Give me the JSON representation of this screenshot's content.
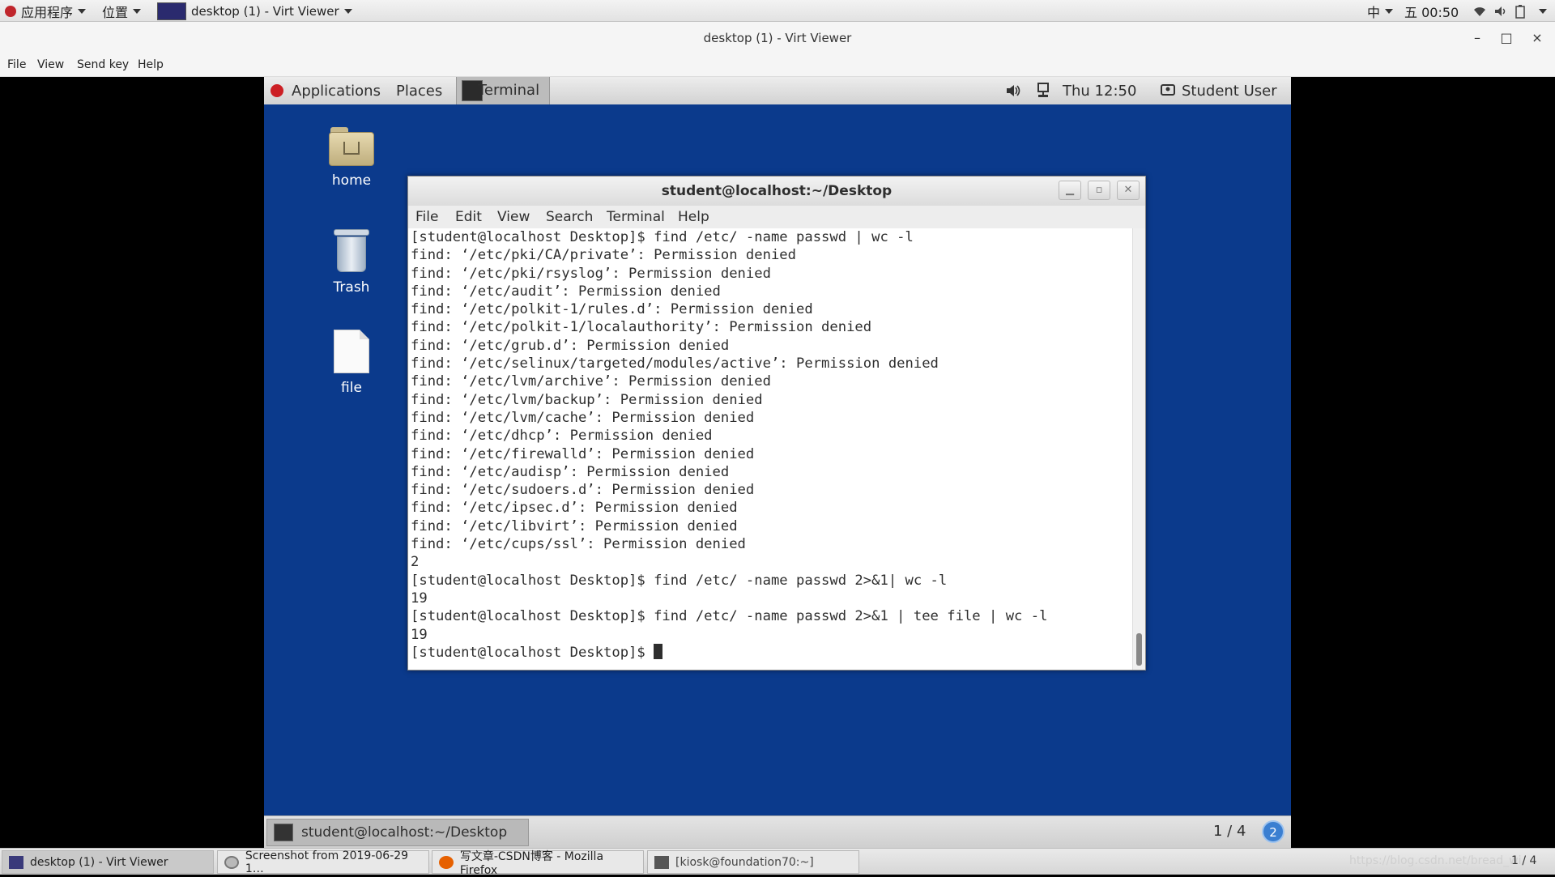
{
  "host_topbar": {
    "apps": "应用程序",
    "places": "位置",
    "window": "desktop (1) - Virt Viewer",
    "input_method": "中",
    "clock": "五 00:50"
  },
  "viewer": {
    "title": "desktop (1) - Virt Viewer",
    "menu": [
      "File",
      "View",
      "Send key",
      "Help"
    ],
    "controls": [
      "–",
      "□",
      "×"
    ]
  },
  "guest": {
    "topbar": {
      "applications": "Applications",
      "places": "Places",
      "terminal": "Terminal",
      "clock": "Thu 12:50",
      "user": "Student User"
    },
    "desktop_icons": [
      "home",
      "Trash",
      "file"
    ],
    "terminal": {
      "title": "student@localhost:~/Desktop",
      "menu": [
        "File",
        "Edit",
        "View",
        "Search",
        "Terminal",
        "Help"
      ],
      "lines": [
        "[student@localhost Desktop]$ find /etc/ -name passwd | wc -l",
        "find: ‘/etc/pki/CA/private’: Permission denied",
        "find: ‘/etc/pki/rsyslog’: Permission denied",
        "find: ‘/etc/audit’: Permission denied",
        "find: ‘/etc/polkit-1/rules.d’: Permission denied",
        "find: ‘/etc/polkit-1/localauthority’: Permission denied",
        "find: ‘/etc/grub.d’: Permission denied",
        "find: ‘/etc/selinux/targeted/modules/active’: Permission denied",
        "find: ‘/etc/lvm/archive’: Permission denied",
        "find: ‘/etc/lvm/backup’: Permission denied",
        "find: ‘/etc/lvm/cache’: Permission denied",
        "find: ‘/etc/dhcp’: Permission denied",
        "find: ‘/etc/firewalld’: Permission denied",
        "find: ‘/etc/audisp’: Permission denied",
        "find: ‘/etc/sudoers.d’: Permission denied",
        "find: ‘/etc/ipsec.d’: Permission denied",
        "find: ‘/etc/libvirt’: Permission denied",
        "find: ‘/etc/cups/ssl’: Permission denied",
        "2",
        "[student@localhost Desktop]$ find /etc/ -name passwd 2>&1| wc -l",
        "19",
        "[student@localhost Desktop]$ find /etc/ -name passwd 2>&1 | tee file | wc -l",
        "19"
      ],
      "prompt": "[student@localhost Desktop]$ "
    },
    "taskbar": {
      "item": "student@localhost:~/Desktop",
      "workspace": "1 / 4",
      "badge": "2"
    }
  },
  "host_taskbar": {
    "items": [
      "desktop (1) - Virt Viewer",
      "Screenshot from 2019-06-29 1…",
      "写文章-CSDN博客 - Mozilla Firefox",
      "[kiosk@foundation70:~]"
    ],
    "watermark": "https://blog.csdn.net/bread_wi",
    "page": "1 / 4"
  }
}
